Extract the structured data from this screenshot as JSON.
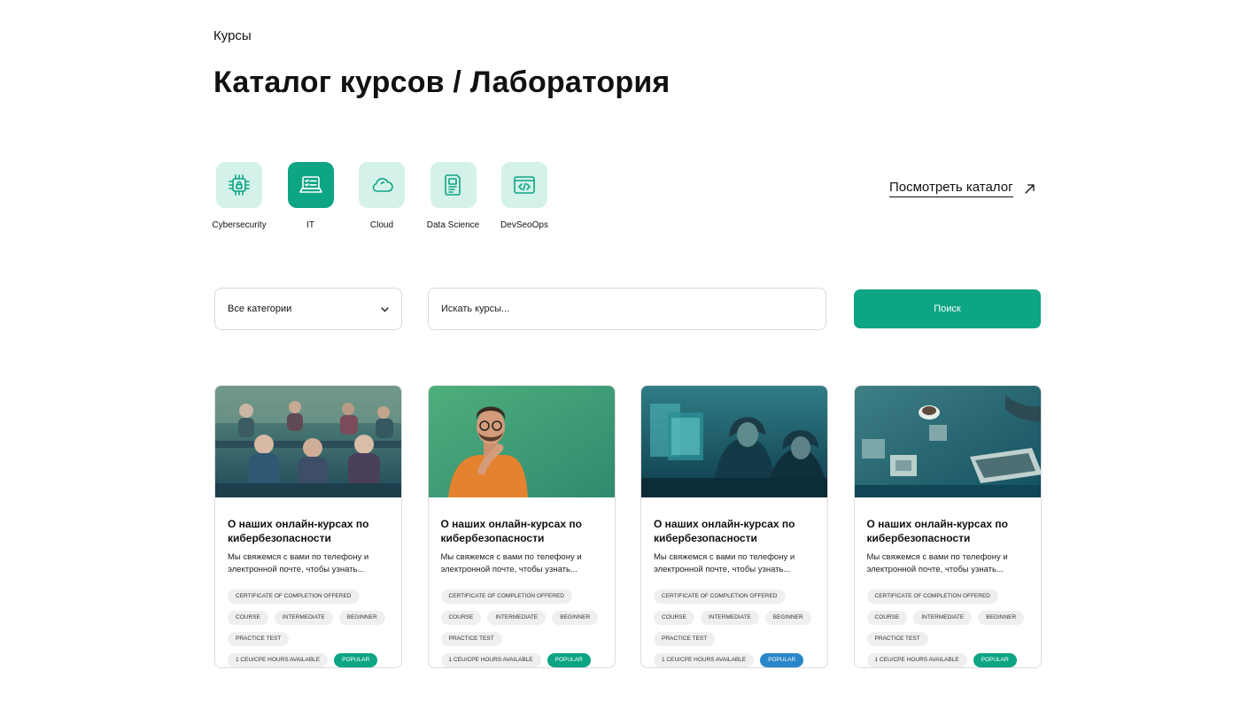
{
  "header": {
    "eyebrow": "Курсы",
    "title": "Каталог курсов / Лаборатория"
  },
  "categories": [
    {
      "label": "Cybersecurity",
      "icon": "chip-lock-icon",
      "active": false
    },
    {
      "label": "IT",
      "icon": "laptop-checklist-icon",
      "active": true
    },
    {
      "label": "Cloud",
      "icon": "cloud-icon",
      "active": false
    },
    {
      "label": "Data Science",
      "icon": "document-chart-icon",
      "active": false
    },
    {
      "label": "DevSeoOps",
      "icon": "code-window-icon",
      "active": false
    }
  ],
  "catalog_link": {
    "label": "Посмотреть каталог",
    "icon": "arrow-up-right-icon"
  },
  "filter": {
    "category_select": "Все категории",
    "search_placeholder": "Искать курсы...",
    "search_button": "Поиск"
  },
  "colors": {
    "accent": "#0ea584",
    "accent_light": "#d4f2ea",
    "popular_green": "#0ea584",
    "popular_blue": "#2a86c9"
  },
  "cards": [
    {
      "image": "students-group-photo",
      "title": "О наших онлайн-курсах по кибербезопасности",
      "desc": "Мы свяжемся с вами по телефону и электронной почте, чтобы узнать...",
      "tags": [
        "Certificate of Completion Offered",
        "Course",
        "Intermediate",
        "Beginner",
        "Practice Test",
        "1 CEU/CPE Hours Available"
      ],
      "badge": "Popular",
      "badge_color": "#0ea584"
    },
    {
      "image": "man-thinking-photo",
      "title": "О наших онлайн-курсах по кибербезопасности",
      "desc": "Мы свяжемся с вами по телефону и электронной почте, чтобы узнать...",
      "tags": [
        "Certificate of Completion Offered",
        "Course",
        "Intermediate",
        "Beginner",
        "Practice Test",
        "1 CEU/CPE Hours Available"
      ],
      "badge": "Popular",
      "badge_color": "#0ea584"
    },
    {
      "image": "hackers-at-computers-photo",
      "title": "О наших онлайн-курсах по кибербезопасности",
      "desc": "Мы свяжемся с вами по телефону и электронной почте, чтобы узнать...",
      "tags": [
        "Certificate of Completion Offered",
        "Course",
        "Intermediate",
        "Beginner",
        "Practice Test",
        "1 CEU/CPE Hours Available"
      ],
      "badge": "Popular",
      "badge_color": "#2a86c9"
    },
    {
      "image": "chips-and-laptop-photo",
      "title": "О наших онлайн-курсах по кибербезопасности",
      "desc": "Мы свяжемся с вами по телефону и электронной почте, чтобы узнать...",
      "tags": [
        "Certificate of Completion Offered",
        "Course",
        "Intermediate",
        "Beginner",
        "Practice Test",
        "1 CEU/CPE Hours Available"
      ],
      "badge": "Popular",
      "badge_color": "#0ea584"
    }
  ]
}
